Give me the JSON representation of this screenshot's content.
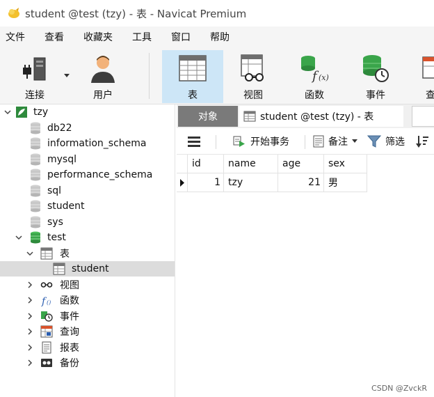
{
  "window": {
    "title": "student @test (tzy) - 表 - Navicat Premium"
  },
  "menubar": {
    "items": [
      "文件",
      "查看",
      "收藏夹",
      "工具",
      "窗口",
      "帮助"
    ]
  },
  "toolbar": {
    "items": [
      {
        "label": "连接",
        "icon": "connection-icon"
      },
      {
        "label": "用户",
        "icon": "user-icon"
      },
      {
        "label": "表",
        "icon": "table-icon",
        "active": true
      },
      {
        "label": "视图",
        "icon": "view-icon"
      },
      {
        "label": "函数",
        "icon": "function-icon"
      },
      {
        "label": "事件",
        "icon": "event-icon"
      },
      {
        "label": "查",
        "icon": "query-icon"
      }
    ]
  },
  "tree": {
    "connection": "tzy",
    "databases": [
      "db22",
      "information_schema",
      "mysql",
      "performance_schema",
      "sql",
      "student",
      "sys"
    ],
    "open_db": "test",
    "tables_label": "表",
    "selected_table": "student",
    "children": [
      "视图",
      "函数",
      "事件",
      "查询",
      "报表",
      "备份"
    ]
  },
  "tabs": {
    "objects": "对象",
    "current": "student @test (tzy) - 表"
  },
  "subtoolbar": {
    "menu_icon": "hamburger-icon",
    "begin_transaction": "开始事务",
    "note": "备注",
    "filter": "筛选"
  },
  "grid": {
    "columns": [
      "id",
      "name",
      "age",
      "sex"
    ],
    "rows": [
      {
        "id": "1",
        "name": "tzy",
        "age": "21",
        "sex": "男"
      }
    ]
  },
  "watermark": "CSDN @ZvckR",
  "colors": {
    "active_tool_bg": "#cde6f7",
    "selected_row_bg": "#dcdcdc",
    "objects_tab_bg": "#7a7a7a",
    "db_icon_gray": "#c8c8c8",
    "db_icon_green": "#3aa54a"
  }
}
